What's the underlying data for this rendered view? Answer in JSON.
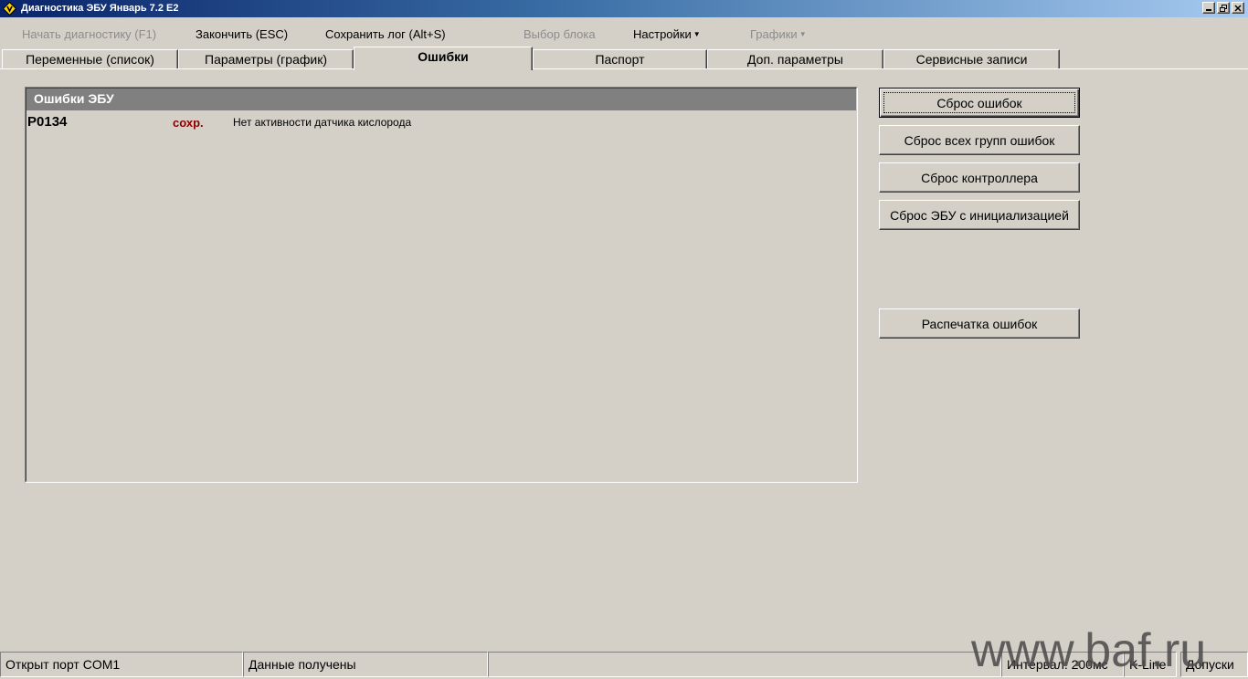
{
  "window": {
    "title": "Диагностика ЭБУ Январь 7.2 E2",
    "icon": "app-logo-icon"
  },
  "menu": {
    "start": "Начать диагностику (F1)",
    "finish": "Закончить (ESC)",
    "save_log": "Сохранить лог (Alt+S)",
    "select_block": "Выбор блока",
    "settings": "Настройки",
    "charts": "Графики"
  },
  "tabs": [
    {
      "label": "Переменные (список)"
    },
    {
      "label": "Параметры (график)"
    },
    {
      "label": "Ошибки",
      "active": true
    },
    {
      "label": "Паспорт"
    },
    {
      "label": "Доп. параметры"
    },
    {
      "label": "Сервисные записи"
    }
  ],
  "errors_panel": {
    "header": "Ошибки ЭБУ",
    "rows": [
      {
        "code": "P0134",
        "status": "сохр.",
        "description": "Нет активности датчика кислорода"
      }
    ]
  },
  "buttons": {
    "reset_errors": "Сброс ошибок",
    "reset_all_groups": "Сброс всех групп ошибок",
    "reset_controller": "Сброс контроллера",
    "reset_ecu_init": "Сброс ЭБУ с инициализацией",
    "print_errors": "Распечатка ошибок"
  },
  "statusbar": {
    "port": "Открыт порт COM1",
    "data": "Данные получены",
    "empty": "",
    "interval": "Интервал: 200мс",
    "line": "K-Line",
    "access": "Допуски"
  },
  "watermark": "www.baf.ru",
  "colors": {
    "title_gradient_start": "#0a246a",
    "face": "#d4d0c8",
    "panel_header": "#808080",
    "status_saved": "#8b0000",
    "disabled_text": "#8c8c8c"
  }
}
